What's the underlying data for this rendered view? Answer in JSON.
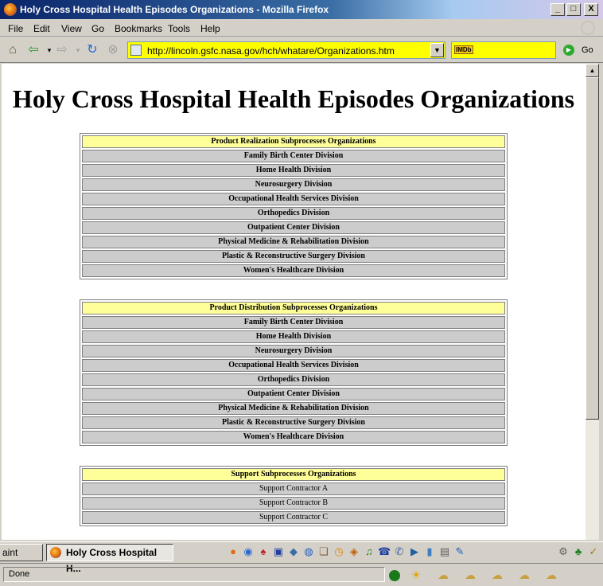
{
  "window": {
    "title": "Holy Cross Hospital Health Episodes Organizations - Mozilla Firefox",
    "minimize": "_",
    "maximize": "□",
    "close": "X"
  },
  "menu": [
    "File",
    "Edit",
    "View",
    "Go",
    "Bookmarks",
    "Tools",
    "Help"
  ],
  "nav": {
    "url": "http://lincoln.gsfc.nasa.gov/hch/whatare/Organizations.htm",
    "search_engine": "IMDb",
    "go_label": "Go"
  },
  "page": {
    "title": "Holy Cross Hospital Health Episodes Organizations",
    "tables": [
      {
        "header": "Product Realization Subprocesses Organizations",
        "rows": [
          "Family Birth Center Division",
          "Home Health Division",
          "Neurosurgery Division",
          "Occupational Health Services Division",
          "Orthopedics Division",
          "Outpatient Center Division",
          "Physical Medicine & Rehabilitation Division",
          "Plastic & Reconstructive Surgery Division",
          "Women's Healthcare Division"
        ]
      },
      {
        "header": "Product Distribution Subprocesses Organizations",
        "rows": [
          "Family Birth Center Division",
          "Home Health Division",
          "Neurosurgery Division",
          "Occupational Health Services Division",
          "Orthopedics Division",
          "Outpatient Center Division",
          "Physical Medicine & Rehabilitation Division",
          "Plastic & Reconstructive Surgery Division",
          "Women's Healthcare Division"
        ]
      },
      {
        "header": "Support Subprocesses Organizations",
        "rows": [
          "Support Contractor A",
          "Support Contractor B",
          "Support Contractor C"
        ]
      }
    ]
  },
  "taskbar": {
    "items": [
      "aint",
      "Holy Cross Hospital H..."
    ]
  },
  "status": {
    "text": "Done"
  },
  "colors": {
    "header_bg": "#ffff99",
    "row_bg": "#cccccc",
    "url_bg": "#ffff00"
  }
}
